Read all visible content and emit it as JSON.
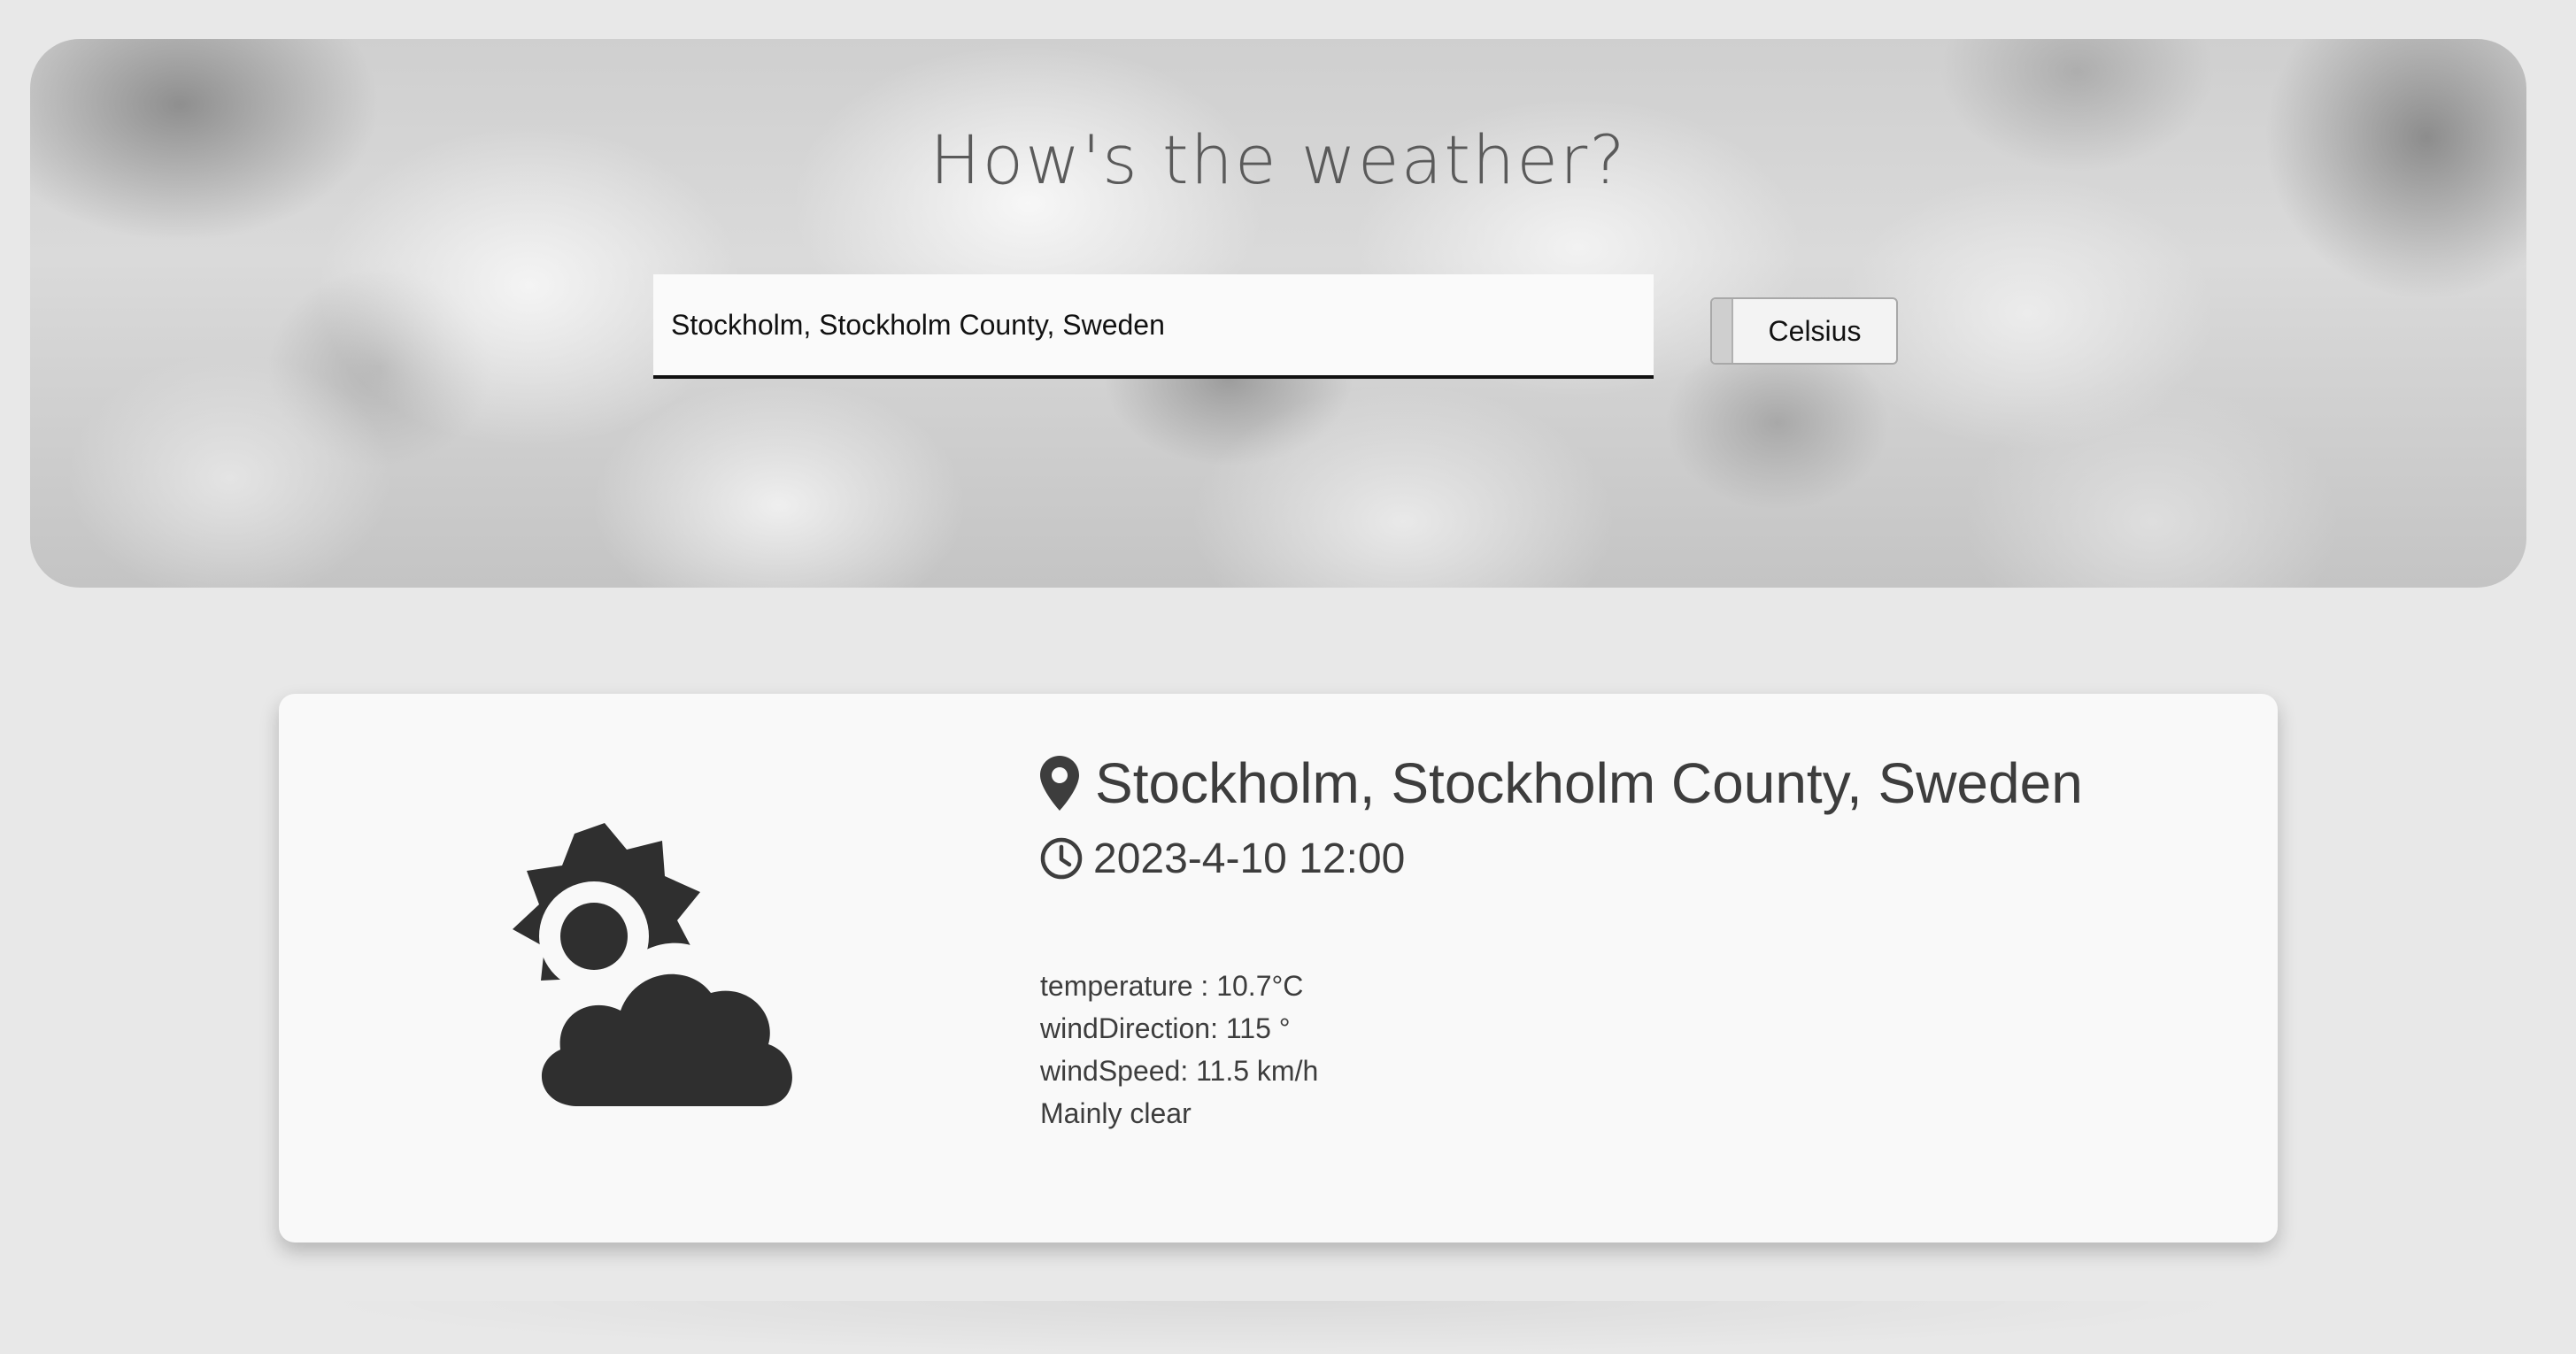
{
  "header": {
    "title": "How's the weather?"
  },
  "search": {
    "value": "Stockholm, Stockholm County, Sweden"
  },
  "unit_toggle": {
    "label": "Celsius"
  },
  "weather": {
    "location": "Stockholm, Stockholm County, Sweden",
    "datetime": "2023-4-10 12:00",
    "icon": "partly-cloudy-day-icon",
    "details": {
      "temperature": "temperature : 10.7°C",
      "wind_direction": "windDirection: 115 °",
      "wind_speed": "windSpeed: 11.5 km/h",
      "condition": "Mainly clear"
    }
  },
  "colors": {
    "page_background": "#e8e8e8",
    "card_background": "#f9f9f9",
    "text": "#3d3d3d",
    "icon": "#2f2f2f"
  }
}
